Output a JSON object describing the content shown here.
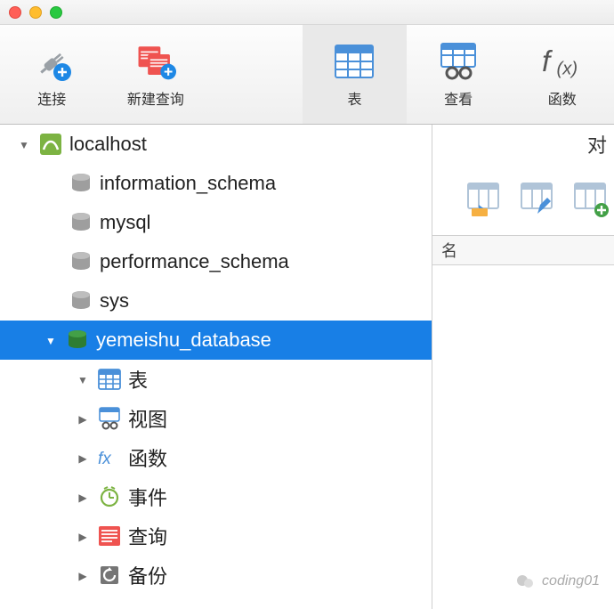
{
  "toolbar": {
    "connect": "连接",
    "newQuery": "新建查询",
    "table": "表",
    "view": "查看",
    "function": "函数"
  },
  "rightPane": {
    "titleFragment": "对",
    "columnName": "名"
  },
  "tree": {
    "connection": "localhost",
    "databases": {
      "d0": "information_schema",
      "d1": "mysql",
      "d2": "performance_schema",
      "d3": "sys",
      "d4": "yemeishu_database"
    },
    "children": {
      "tables": "表",
      "views": "视图",
      "functions": "函数",
      "events": "事件",
      "queries": "查询",
      "backups": "备份"
    }
  },
  "watermark": "coding01"
}
